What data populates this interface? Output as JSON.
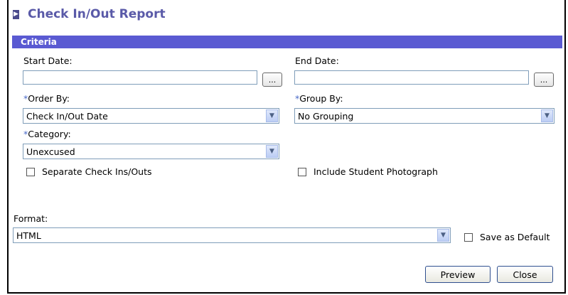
{
  "header": {
    "title": "Check In/Out Report"
  },
  "criteria": {
    "section_label": "Criteria"
  },
  "fields": {
    "start_date": {
      "label": "Start Date:",
      "value": "",
      "picker_label": "..."
    },
    "end_date": {
      "label": "End Date:",
      "value": "",
      "picker_label": "..."
    },
    "order_by": {
      "required_mark": "*",
      "label": "Order By:",
      "value": "Check In/Out Date"
    },
    "group_by": {
      "required_mark": "*",
      "label": "Group By:",
      "value": "No Grouping"
    },
    "category": {
      "required_mark": "*",
      "label": "Category:",
      "value": "Unexcused"
    }
  },
  "options": {
    "separate_check": {
      "label": "Separate Check Ins/Outs",
      "checked": false
    },
    "include_photo": {
      "label": "Include Student Photograph",
      "checked": false
    }
  },
  "format": {
    "label": "Format:",
    "value": "HTML",
    "save_default_label": "Save as Default",
    "save_default_checked": false
  },
  "actions": {
    "preview_label": "Preview",
    "close_label": "Close"
  },
  "colors": {
    "title": "#5a5aa8",
    "criteria_bar": "#5a5ad2",
    "required": "#4a6ac8"
  }
}
